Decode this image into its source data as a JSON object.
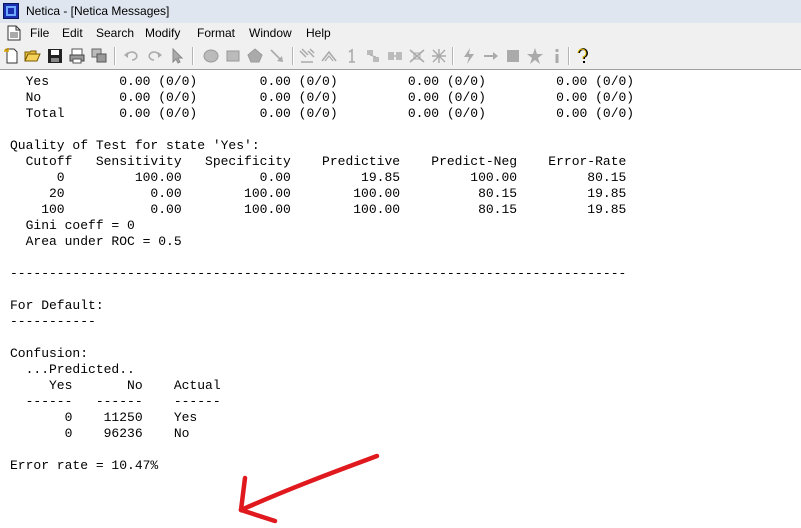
{
  "window": {
    "title": "Netica - [Netica Messages]"
  },
  "menu": [
    "File",
    "Edit",
    "Search",
    "Modify",
    "Format",
    "Window",
    "Help"
  ],
  "toolbar": [
    "new-file",
    "open-folder",
    "save",
    "print",
    "cascade",
    "undo",
    "redo",
    "select-arrow",
    "oval-node",
    "filled-node",
    "decision-node",
    "link-arrow",
    "compile",
    "absorb",
    "one-number",
    "add-finding",
    "remove-finding",
    "dependent",
    "gear",
    "lightning",
    "right-arrow",
    "box",
    "star",
    "info",
    "help"
  ],
  "messages": {
    "lines": [
      "  Yes         0.00 (0/0)        0.00 (0/0)         0.00 (0/0)         0.00 (0/0)",
      "  No          0.00 (0/0)        0.00 (0/0)         0.00 (0/0)         0.00 (0/0)",
      "  Total       0.00 (0/0)        0.00 (0/0)         0.00 (0/0)         0.00 (0/0)",
      "",
      "Quality of Test for state 'Yes':",
      "  Cutoff   Sensitivity   Specificity    Predictive    Predict-Neg    Error-Rate",
      "      0         100.00          0.00         19.85         100.00         80.15",
      "     20           0.00        100.00        100.00          80.15         19.85",
      "    100           0.00        100.00        100.00          80.15         19.85",
      "  Gini coeff = 0",
      "  Area under ROC = 0.5",
      "",
      "-------------------------------------------------------------------------------",
      "",
      "For Default:",
      "-----------",
      "",
      "Confusion:",
      "  ...Predicted..",
      "     Yes       No    Actual",
      "  ------   ------    ------",
      "       0    11250    Yes",
      "       0    96236    No",
      "",
      "Error rate = 10.47%"
    ]
  },
  "annotation": {
    "color": "#e0191f"
  },
  "colors": {
    "titlebar": "#dfe6ef",
    "chrome": "#f0f0f0"
  }
}
